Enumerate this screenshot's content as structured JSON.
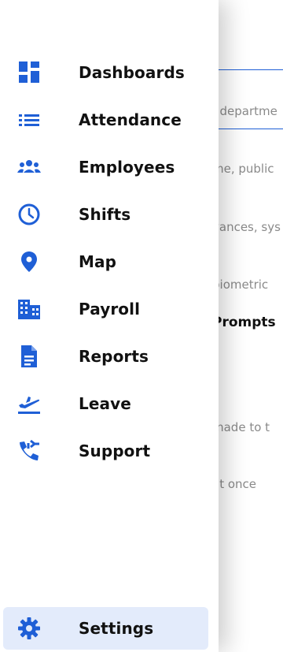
{
  "drawer": {
    "items": [
      {
        "label": "Dashboards",
        "icon": "dashboard-icon"
      },
      {
        "label": "Attendance",
        "icon": "list-icon"
      },
      {
        "label": "Employees",
        "icon": "people-icon"
      },
      {
        "label": "Shifts",
        "icon": "clock-icon"
      },
      {
        "label": "Map",
        "icon": "location-pin-icon"
      },
      {
        "label": "Payroll",
        "icon": "building-icon"
      },
      {
        "label": "Reports",
        "icon": "document-icon"
      },
      {
        "label": "Leave",
        "icon": "flight-takeoff-icon"
      },
      {
        "label": "Support",
        "icon": "phone-forward-icon"
      }
    ],
    "settings": {
      "label": "Settings",
      "icon": "gear-icon"
    }
  },
  "background": {
    "department_hint": ", departme",
    "public_hint": "me, public",
    "advances_hint": "vances, sys",
    "biometric_hint": "biometric",
    "prompts_heading": "Prompts",
    "made_to_hint": "made to t",
    "at_once_hint": "at once"
  },
  "colors": {
    "accent": "#1f5fd6",
    "settings_bg": "#e3ebfb",
    "label": "#111111"
  }
}
